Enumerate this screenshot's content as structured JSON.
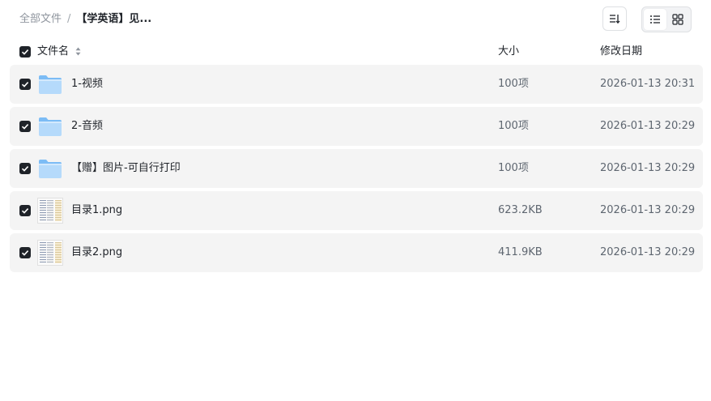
{
  "breadcrumb": {
    "root": "全部文件",
    "separator": "/",
    "current": "【学英语】见..."
  },
  "toolbar": {
    "sort_icon": "sort-list-icon",
    "list_view_icon": "list-view-icon",
    "grid_view_icon": "grid-view-icon",
    "active_view": "list"
  },
  "columns": {
    "name": "文件名",
    "size": "大小",
    "modified": "修改日期"
  },
  "select_all_checked": true,
  "files": [
    {
      "name": "1-视频",
      "size": "100项",
      "modified": "2026-01-13 20:31",
      "type": "folder",
      "checked": true
    },
    {
      "name": "2-音频",
      "size": "100项",
      "modified": "2026-01-13 20:29",
      "type": "folder",
      "checked": true
    },
    {
      "name": "【赠】图片-可自行打印",
      "size": "100项",
      "modified": "2026-01-13 20:29",
      "type": "folder",
      "checked": true
    },
    {
      "name": "目录1.png",
      "size": "623.2KB",
      "modified": "2026-01-13 20:29",
      "type": "image",
      "checked": true
    },
    {
      "name": "目录2.png",
      "size": "411.9KB",
      "modified": "2026-01-13 20:29",
      "type": "image",
      "checked": true
    }
  ],
  "colors": {
    "row_bg": "#f4f4f4",
    "checkbox": "#1f2329",
    "folder_light": "#b5dafb",
    "folder_dark": "#7cbcf5",
    "muted_text": "#8f959e"
  }
}
